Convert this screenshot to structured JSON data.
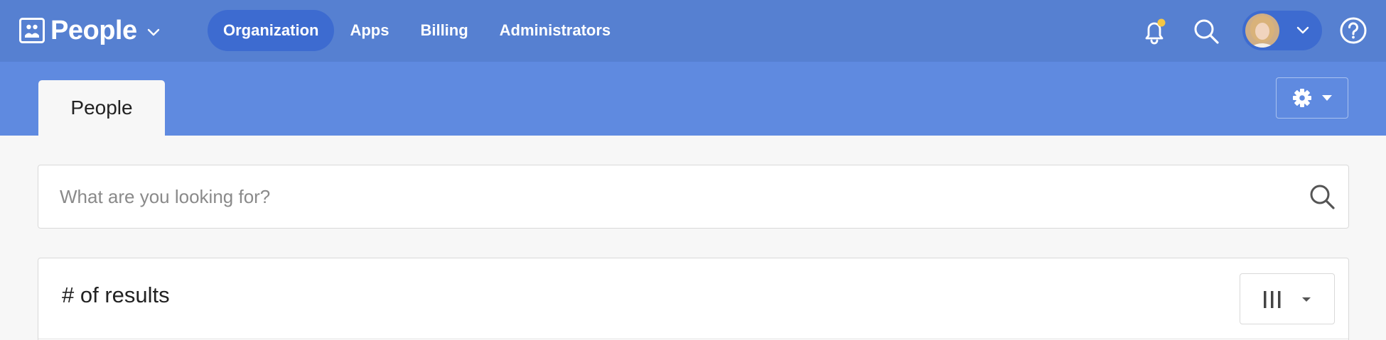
{
  "brand": {
    "name": "People",
    "logo_icon": "people-directory-icon"
  },
  "nav": [
    {
      "label": "Organization",
      "active": true
    },
    {
      "label": "Apps",
      "active": false
    },
    {
      "label": "Billing",
      "active": false
    },
    {
      "label": "Administrators",
      "active": false
    }
  ],
  "header_icons": [
    "bell-icon",
    "search-icon",
    "avatar",
    "chevron-down-icon",
    "help-icon"
  ],
  "tabs": [
    {
      "label": "People",
      "active": true
    }
  ],
  "search": {
    "placeholder": "What are you looking for?",
    "value": ""
  },
  "results": {
    "title": "# of results"
  },
  "colors": {
    "topbar": "#5680d1",
    "nav_active": "#3d6bd0",
    "subbar": "#5f8ae0",
    "notification_dot": "#f6c744",
    "page_bg": "#f7f7f7"
  }
}
